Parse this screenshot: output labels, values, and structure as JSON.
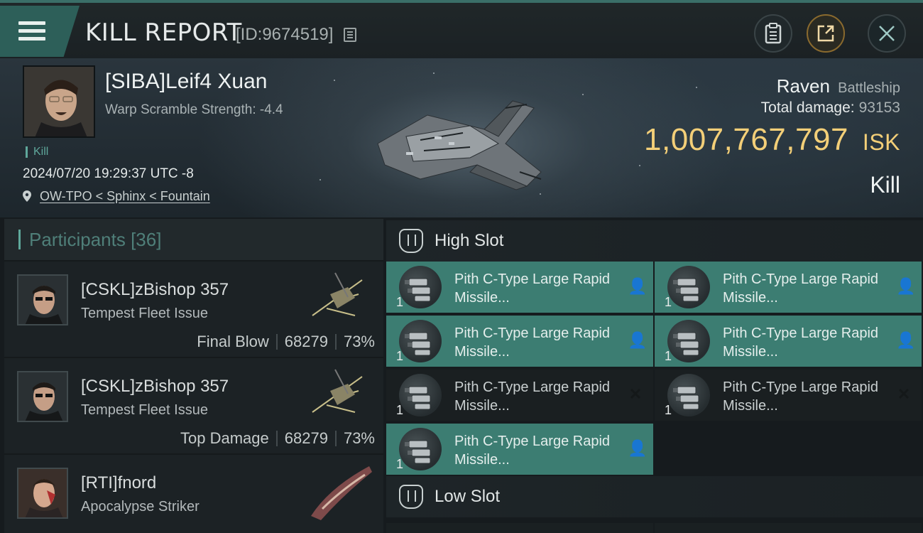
{
  "topbar": {
    "title": "KILL REPORT",
    "report_id": "[ID:9674519]",
    "icons": [
      "menu-icon",
      "copy-icon",
      "clipboard-icon",
      "share-icon",
      "close-icon"
    ]
  },
  "victim": {
    "name": "[SIBA]Leif4 Xuan",
    "subtitle": "Warp Scramble Strength: -4.4",
    "tag": "Kill",
    "datetime": "2024/07/20 19:29:37 UTC -8",
    "location": "OW-TPO < Sphinx < Fountain",
    "ship_name": "Raven",
    "ship_class": "Battleship",
    "total_damage_label": "Total damage:",
    "total_damage": "93153",
    "isk_value": "1,007,767,797",
    "isk_unit": "ISK",
    "result": "Kill"
  },
  "participants": {
    "label": "Participants",
    "count": "[36]",
    "rows": [
      {
        "name": "[CSKL]zBishop 357",
        "ship": "Tempest Fleet Issue",
        "role": "Final Blow",
        "damage": "68279",
        "percent": "73%"
      },
      {
        "name": "[CSKL]zBishop 357",
        "ship": "Tempest Fleet Issue",
        "role": "Top Damage",
        "damage": "68279",
        "percent": "73%"
      },
      {
        "name": "[RTI]fnord",
        "ship": "Apocalypse Striker"
      }
    ]
  },
  "high_slot": {
    "label": "High Slot",
    "modules": [
      {
        "name": "Pith C-Type Large Rapid Missile...",
        "qty": "1",
        "state": "dropped"
      },
      {
        "name": "Pith C-Type Large Rapid Missile...",
        "qty": "1",
        "state": "dropped"
      },
      {
        "name": "Pith C-Type Large Rapid Missile...",
        "qty": "1",
        "state": "dropped"
      },
      {
        "name": "Pith C-Type Large Rapid Missile...",
        "qty": "1",
        "state": "dropped"
      },
      {
        "name": "Pith C-Type Large Rapid Missile...",
        "qty": "1",
        "state": "destroyed"
      },
      {
        "name": "Pith C-Type Large Rapid Missile...",
        "qty": "1",
        "state": "destroyed"
      },
      {
        "name": "Pith C-Type Large Rapid Missile...",
        "qty": "1",
        "state": "dropped"
      }
    ]
  },
  "low_slot": {
    "label": "Low Slot"
  },
  "colors": {
    "accent": "#5fa89b",
    "dropped_bg": "#3c7d72",
    "destroyed_bg": "#1a1f21",
    "isk": "#f3cf78"
  }
}
